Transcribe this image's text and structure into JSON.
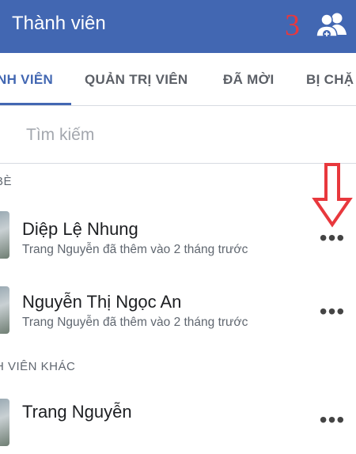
{
  "header": {
    "title": "Thành viên",
    "step_number": "3",
    "icon": "add-member-icon",
    "background": "#4267b2"
  },
  "tabs": [
    {
      "label": "NH VIÊN",
      "active": true
    },
    {
      "label": "QUẢN TRỊ VIÊN",
      "active": false
    },
    {
      "label": "ĐÃ MỜI",
      "active": false
    },
    {
      "label": "BỊ CHẶ",
      "active": false
    }
  ],
  "search": {
    "placeholder": "Tìm kiếm",
    "value": ""
  },
  "sections": {
    "friends_header": "BÈ",
    "others_header": "H VIÊN KHÁC"
  },
  "members": [
    {
      "name": "Diệp Lệ Nhung",
      "subtitle": "Trang Nguyễn đã thêm vào 2 tháng trước",
      "more": "•••"
    },
    {
      "name": "Nguyễn Thị Ngọc An",
      "subtitle": "Trang Nguyễn đã thêm vào 2 tháng trước",
      "more": "•••"
    },
    {
      "name": "Trang Nguyễn",
      "more": "•••"
    }
  ],
  "annotation": {
    "arrow_color": "#e8383d"
  }
}
